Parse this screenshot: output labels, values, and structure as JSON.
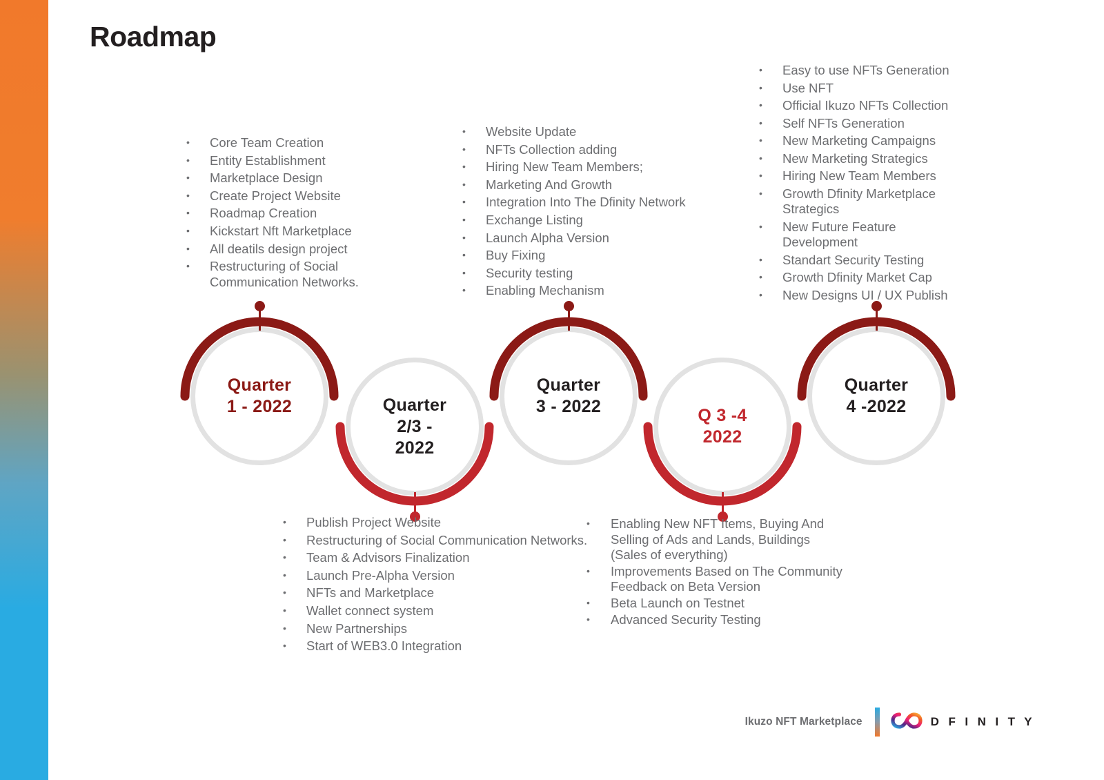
{
  "page": {
    "title": "Roadmap",
    "background": "#ffffff"
  },
  "colors": {
    "maroon": "#8B1A16",
    "red": "#C1272D",
    "ring_gray": "#E2E2E2",
    "text_gray": "#6D6E71",
    "title_black": "#231F20",
    "bar_orange": "#F1792B",
    "bar_blue": "#29ABE2"
  },
  "lists": {
    "q1_top": [
      "Core Team Creation",
      "Entity Establishment",
      "Marketplace Design",
      "Create Project Website",
      "Roadmap Creation",
      "Kickstart Nft Marketplace",
      "All deatils design project",
      "Restructuring of Social Communication Networks."
    ],
    "q23_top": [
      "Website Update",
      "NFTs Collection adding",
      "Hiring New Team Members;",
      "Marketing And Growth",
      "Integration Into The Dfinity Network",
      "Exchange Listing",
      "Launch Alpha Version",
      "Buy Fixing",
      "Security testing",
      "Enabling Mechanism"
    ],
    "q4_top": [
      "Easy to use NFTs Generation",
      "Use NFT",
      "Official Ikuzo NFTs Collection",
      "Self NFTs Generation",
      "New Marketing Campaigns",
      "New Marketing Strategics",
      "Hiring New Team Members",
      "Growth Dfinity Marketplace Strategics",
      "New Future Feature Development",
      "Standart Security Testing",
      "Growth Dfinity Market Cap",
      "New Designs UI / UX Publish"
    ],
    "q23_bottom": [
      "Publish Project Website",
      "Restructuring of Social Communication Networks.",
      "Team & Advisors Finalization",
      "Launch Pre-Alpha Version",
      "NFTs and Marketplace",
      "Wallet connect system",
      "New Partnerships",
      "Start of WEB3.0 Integration"
    ],
    "q34_bottom": [
      "Enabling New NFT Items, Buying And Selling of Ads and Lands, Buildings (Sales of everything)",
      "Improvements Based on The Community Feedback on Beta Version",
      "Beta Launch on Testnet",
      "Advanced Security Testing"
    ]
  },
  "nodes": [
    {
      "line1": "Quarter",
      "line2": "1 - 2022",
      "line3": "",
      "text_color": "#8B1A16",
      "arc": "top",
      "arc_color": "#8B1A16"
    },
    {
      "line1": "Quarter",
      "line2": "2/3 -",
      "line3": "2022",
      "text_color": "#231F20",
      "arc": "bottom",
      "arc_color": "#C1272D"
    },
    {
      "line1": "Quarter",
      "line2": "3 - 2022",
      "line3": "",
      "text_color": "#231F20",
      "arc": "top",
      "arc_color": "#8B1A16"
    },
    {
      "line1": "Q 3 -4",
      "line2": "2022",
      "line3": "",
      "text_color": "#C1272D",
      "arc": "bottom",
      "arc_color": "#C1272D"
    },
    {
      "line1": "Quarter",
      "line2": "4 -2022",
      "line3": "",
      "text_color": "#231F20",
      "arc": "top",
      "arc_color": "#8B1A16"
    }
  ],
  "footer": {
    "brand": "Ikuzo NFT Marketplace",
    "partner": "D F I N I T Y"
  }
}
